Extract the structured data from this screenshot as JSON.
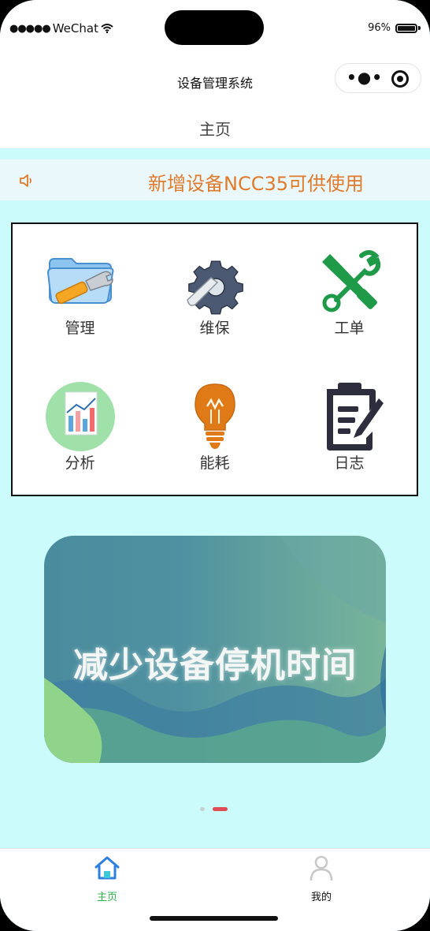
{
  "status_bar": {
    "carrier": "WeChat",
    "battery": "96%"
  },
  "navbar": {
    "title": "设备管理系统"
  },
  "page": {
    "title": "主页"
  },
  "notice": {
    "text": "新增设备NCC35可供使用"
  },
  "grid": [
    {
      "label": "管理",
      "icon": "folder-wrench-icon"
    },
    {
      "label": "维保",
      "icon": "gear-wrench-icon"
    },
    {
      "label": "工单",
      "icon": "tools-icon"
    },
    {
      "label": "分析",
      "icon": "report-chart-icon"
    },
    {
      "label": "能耗",
      "icon": "lightbulb-icon"
    },
    {
      "label": "日志",
      "icon": "clipboard-icon"
    }
  ],
  "banner": {
    "text": "减少设备停机时间",
    "active_slide": 2,
    "slide_count": 2
  },
  "tabbar": [
    {
      "label": "主页",
      "icon": "home-icon",
      "active": true,
      "color": "#2bb24c"
    },
    {
      "label": "我的",
      "icon": "user-icon",
      "active": false,
      "color": "#111111"
    }
  ],
  "colors": {
    "background": "#cbfcfb",
    "notice_text": "#e07b2c",
    "accent_active": "#e04b56"
  }
}
